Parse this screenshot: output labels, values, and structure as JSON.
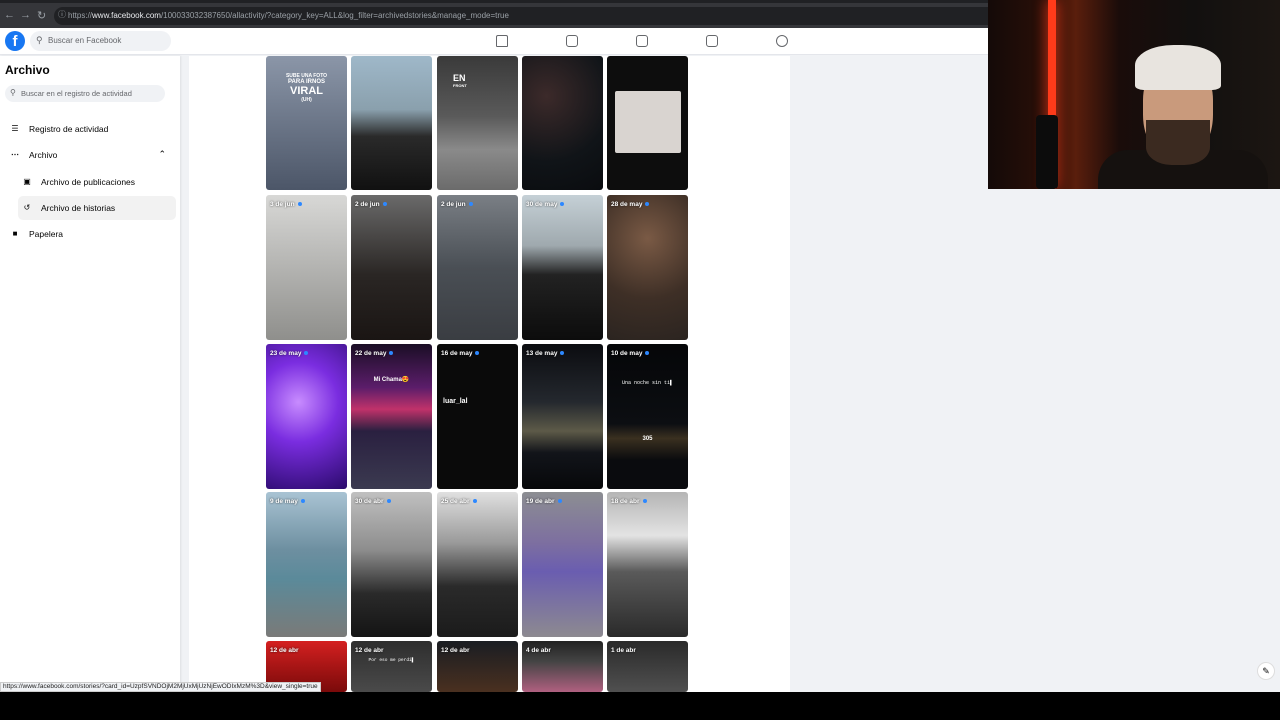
{
  "browser": {
    "url_prefix": "https://",
    "url_domain": "www.facebook.com",
    "url_rest": "/100033032387650/allactivity/?category_key=ALL&log_filter=archivedstories&manage_mode=true"
  },
  "header": {
    "logo": "f",
    "search_placeholder": "Buscar en Facebook"
  },
  "sidebar": {
    "title": "Archivo",
    "search_placeholder": "Buscar en el registro de actividad",
    "items": [
      {
        "label": "Registro de actividad",
        "icon": "list-icon"
      },
      {
        "label": "Archivo",
        "icon": "more-icon"
      },
      {
        "label": "Archivo de publicaciones",
        "icon": "archive-box-icon"
      },
      {
        "label": "Archivo de historias",
        "icon": "history-icon"
      },
      {
        "label": "Papelera",
        "icon": "trash-icon"
      }
    ]
  },
  "stories": {
    "row2": [
      "3 de jun",
      "2 de jun",
      "2 de jun",
      "30 de may",
      "28 de may"
    ],
    "row3": [
      "23 de may",
      "22 de may",
      "16 de may",
      "13 de may",
      "10 de may"
    ],
    "row4": [
      "9 de may",
      "30 de abr",
      "25 de abr",
      "19 de abr",
      "18 de abr"
    ],
    "row5": [
      "12 de abr",
      "12 de abr",
      "12 de abr",
      "4 de abr",
      "1 de abr"
    ],
    "texts": {
      "viral_1": "SUBE UNA FOTO",
      "viral_2": "PARA IRNOS",
      "viral_3": "VIRAL",
      "viral_4": "(UH)",
      "en": "EN",
      "front": "FRONT",
      "chama": "Mi Chama😍",
      "luar": "luar_lal",
      "noche": "Una noche sin ti▌",
      "num305": "305",
      "por": "Por eso me perdí▌"
    }
  },
  "status_url": "https://www.facebook.com/stories/?card_id=UzpfSVNDOjM2MjUxMjUzNjEwODIxMzM%3D&view_single=true"
}
